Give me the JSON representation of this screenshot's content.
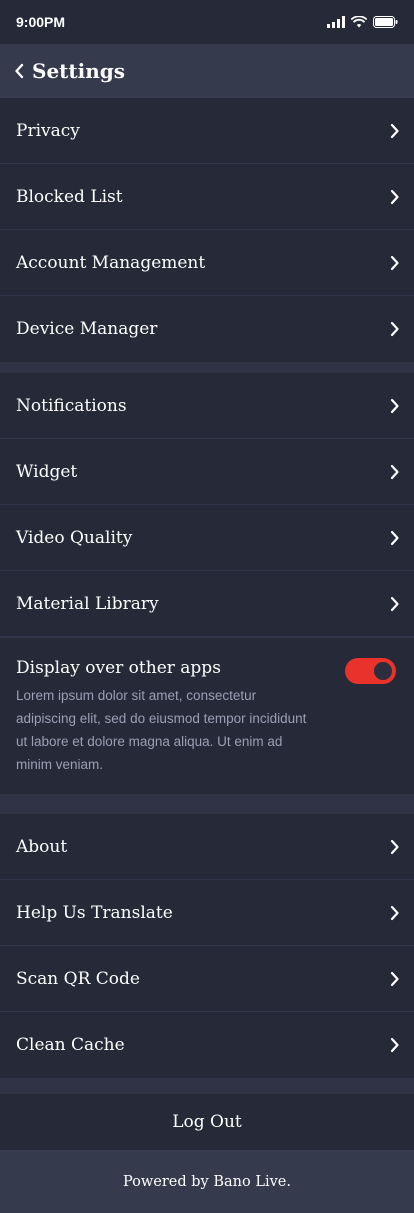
{
  "status_bar": {
    "time": "9:00PM"
  },
  "header": {
    "title": "Settings",
    "back_icon": "chevron-left-icon"
  },
  "group1": [
    {
      "label": "Privacy"
    },
    {
      "label": "Blocked List"
    },
    {
      "label": "Account Management"
    },
    {
      "label": "Device Manager"
    }
  ],
  "group2": [
    {
      "label": "Notifications"
    },
    {
      "label": "Widget"
    },
    {
      "label": "Video Quality"
    },
    {
      "label": "Material Library"
    }
  ],
  "display_over": {
    "label": "Display over other apps",
    "description": "Lorem ipsum dolor sit amet, consectetur adipiscing elit, sed do eiusmod tempor incididunt ut labore et dolore magna aliqua. Ut enim ad minim veniam.",
    "enabled": true
  },
  "group3": [
    {
      "label": "About"
    },
    {
      "label": "Help Us Translate"
    },
    {
      "label": "Scan QR Code"
    },
    {
      "label": "Clean Cache"
    }
  ],
  "logout_label": "Log Out",
  "footer_text": "Powered by Bano Live.",
  "colors": {
    "accent": "#e8322b",
    "background": "#2f3345",
    "row": "#262a38",
    "header": "#353a4d"
  }
}
